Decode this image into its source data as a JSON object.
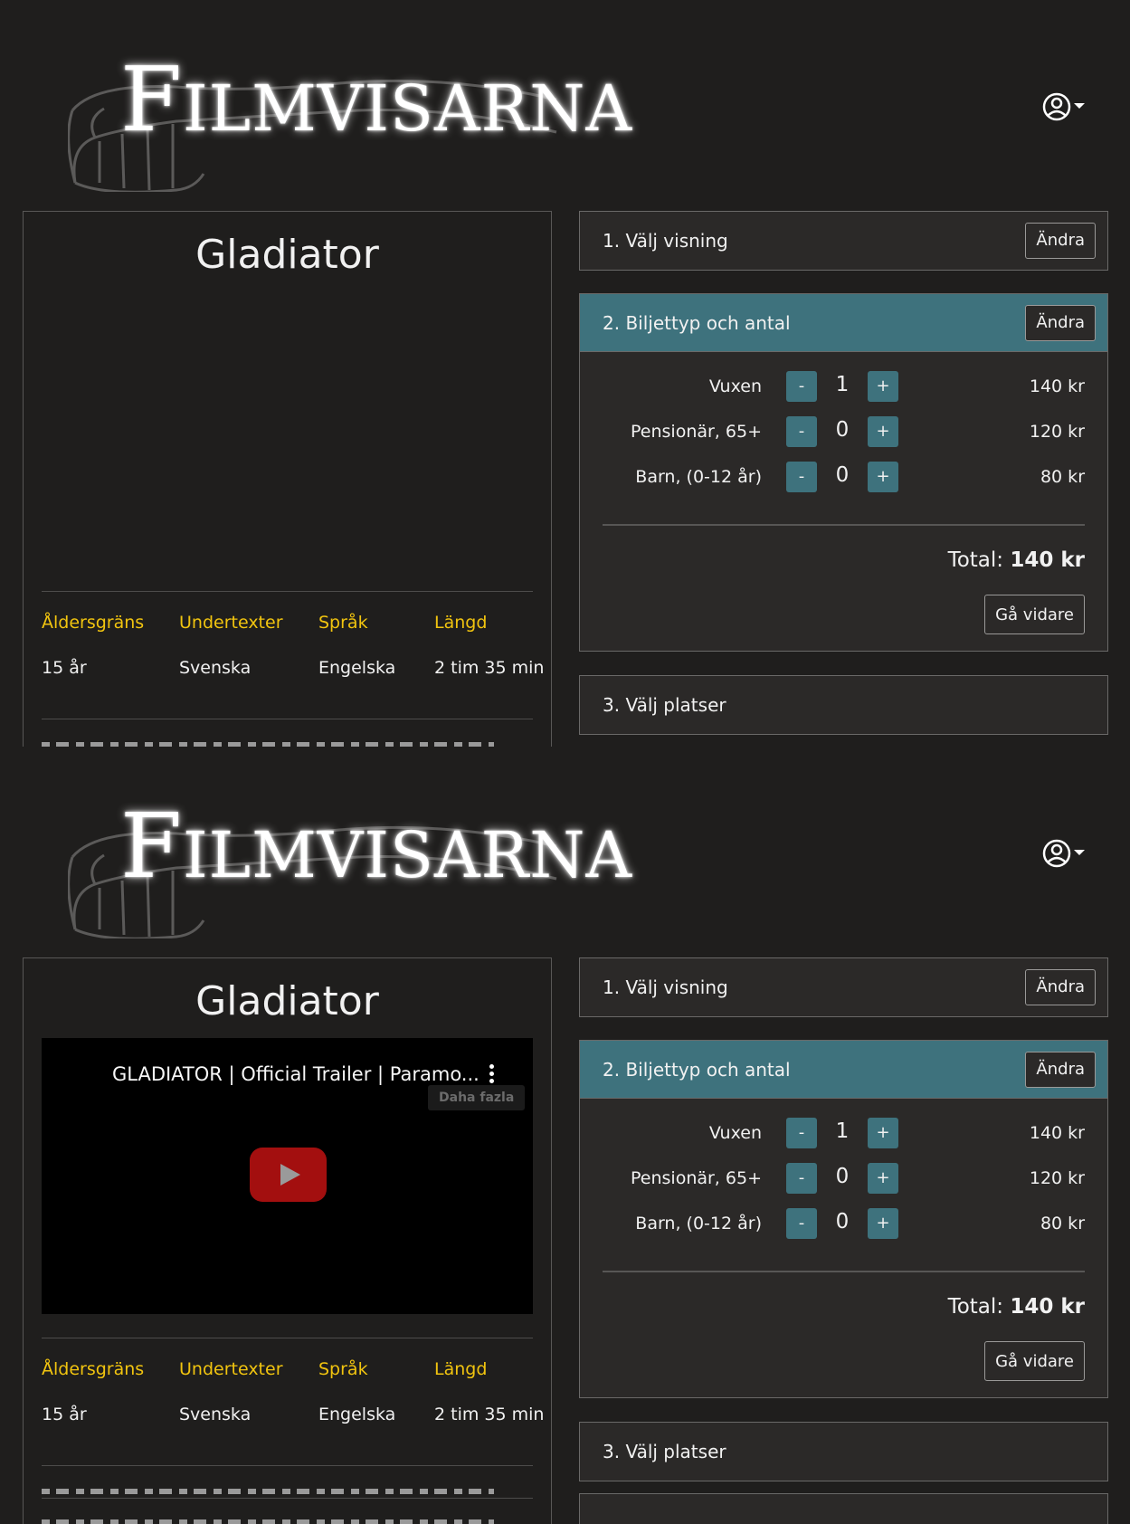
{
  "brand": {
    "logo_first_letter": "F",
    "logo_rest": "ILMVISARNA"
  },
  "movie": {
    "title": "Gladiator",
    "trailer": {
      "title": "GLADIATOR | Official Trailer | Paramo...",
      "tooltip": "Daha fazla"
    },
    "info_labels": [
      "Åldersgräns",
      "Undertexter",
      "Språk",
      "Längd"
    ],
    "info_values": [
      "15 år",
      "Svenska",
      "Engelska",
      "2 tim 35 min"
    ]
  },
  "booking": {
    "change_label": "Ändra",
    "step1_title": "1. Välj visning",
    "step2_title": "2. Biljettyp och antal",
    "step3_title": "3. Välj platser",
    "tickets": [
      {
        "name": "Vuxen",
        "count": "1",
        "price": "140 kr"
      },
      {
        "name": "Pensionär, 65+",
        "count": "0",
        "price": "120 kr"
      },
      {
        "name": "Barn, (0-12 år)",
        "count": "0",
        "price": "80 kr"
      }
    ],
    "minus_label": "-",
    "plus_label": "+",
    "total_label": "Total:",
    "total_value": "140 kr",
    "next_label": "Gå vidare"
  },
  "icons": {
    "user": "user-circle-icon",
    "caret": "caret-down-icon",
    "play": "youtube-play-icon",
    "more": "more-vertical-icon"
  },
  "colors": {
    "accent": "#3e727d",
    "info_label": "#f1c40f",
    "background": "#1f1e1d",
    "panel": "#2b2928"
  }
}
